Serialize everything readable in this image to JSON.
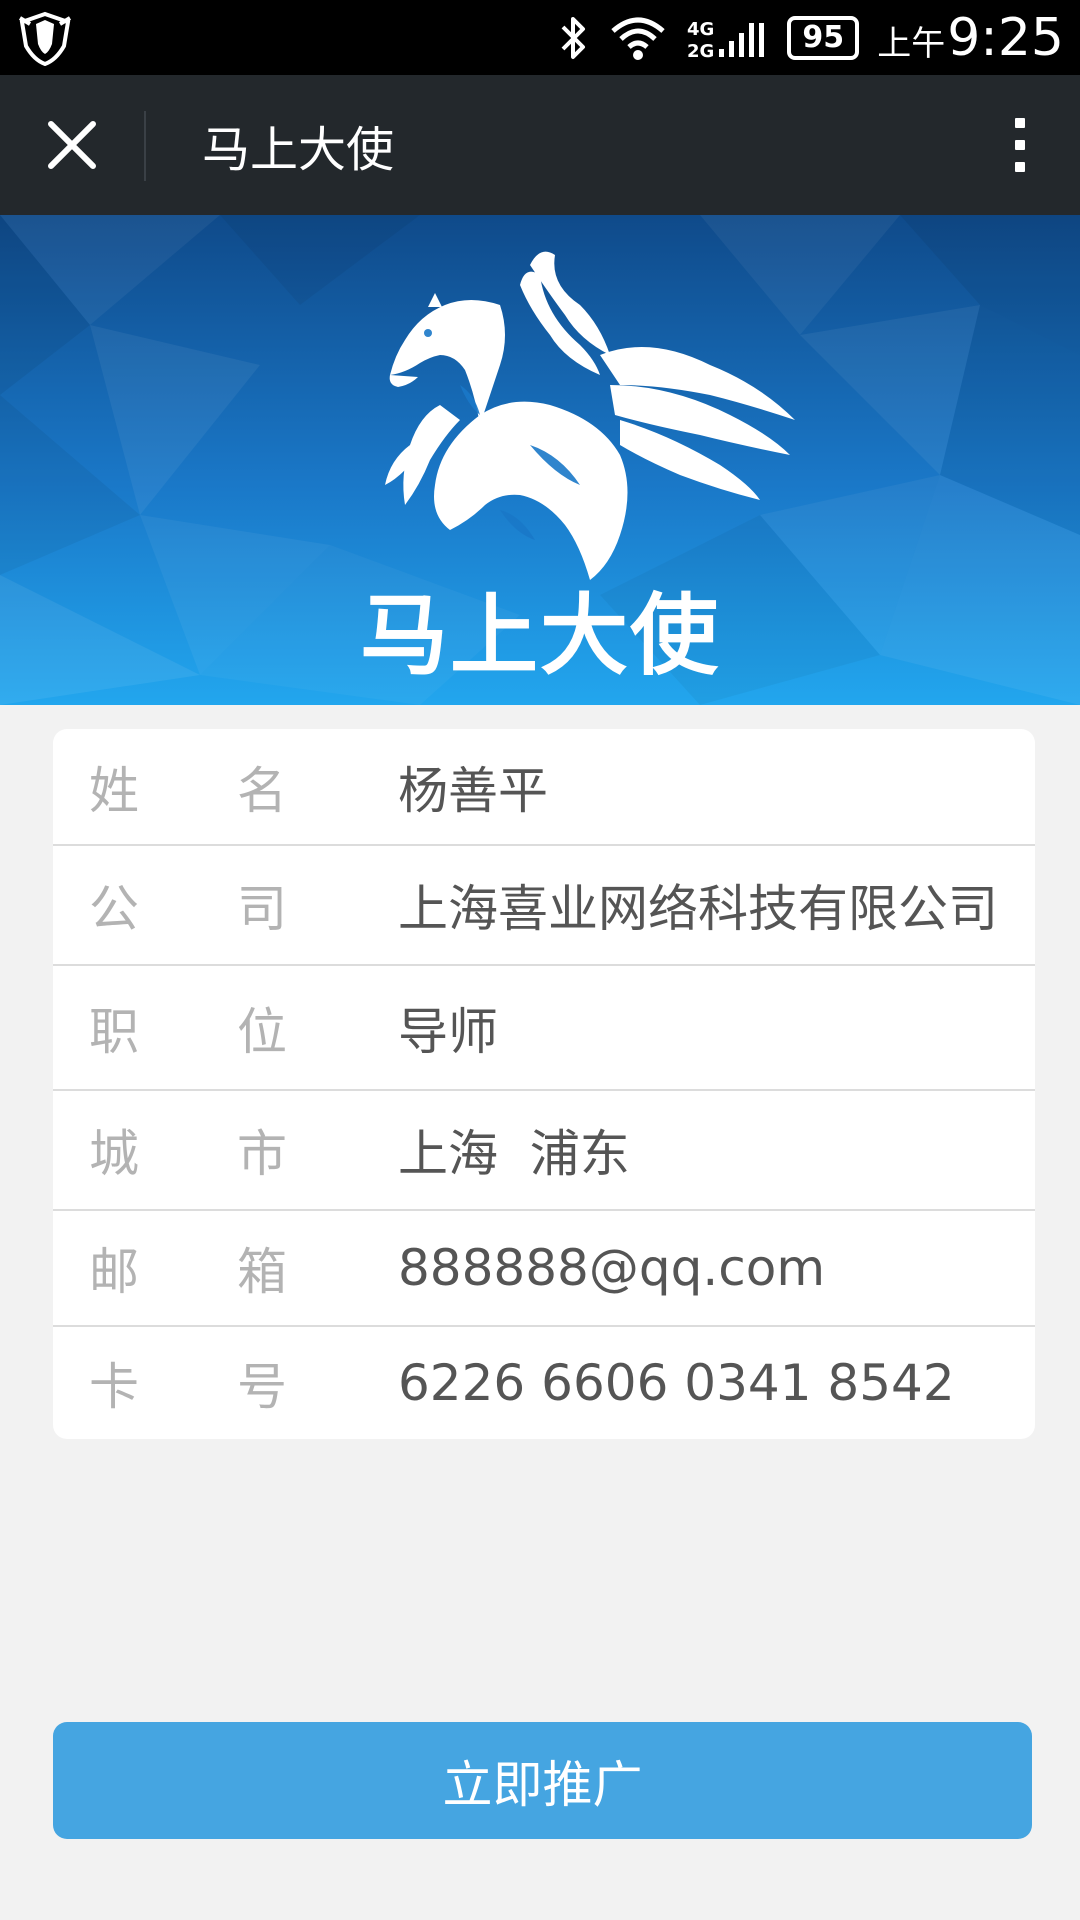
{
  "status_bar": {
    "network": "4G 2G",
    "battery": "95",
    "ampm": "上午",
    "time": "9:25"
  },
  "title_bar": {
    "title": "马上大使"
  },
  "banner": {
    "logo_text": "马上大使",
    "colors": {
      "top": "#0f4a8a",
      "bottom": "#1fa3ea"
    }
  },
  "info": {
    "rows": [
      {
        "label_a": "姓",
        "label_b": "名",
        "value": "杨善平"
      },
      {
        "label_a": "公",
        "label_b": "司",
        "value": "上海喜业网络科技有限公司"
      },
      {
        "label_a": "职",
        "label_b": "位",
        "value": "导师"
      },
      {
        "label_a": "城",
        "label_b": "市",
        "value": "上海  浦东"
      },
      {
        "label_a": "邮",
        "label_b": "箱",
        "value": "888888@qq.com"
      },
      {
        "label_a": "卡",
        "label_b": "号",
        "value": "6226 6606 0341 8542"
      }
    ]
  },
  "action": {
    "promote_label": "立即推广",
    "color": "#45a5e1"
  }
}
